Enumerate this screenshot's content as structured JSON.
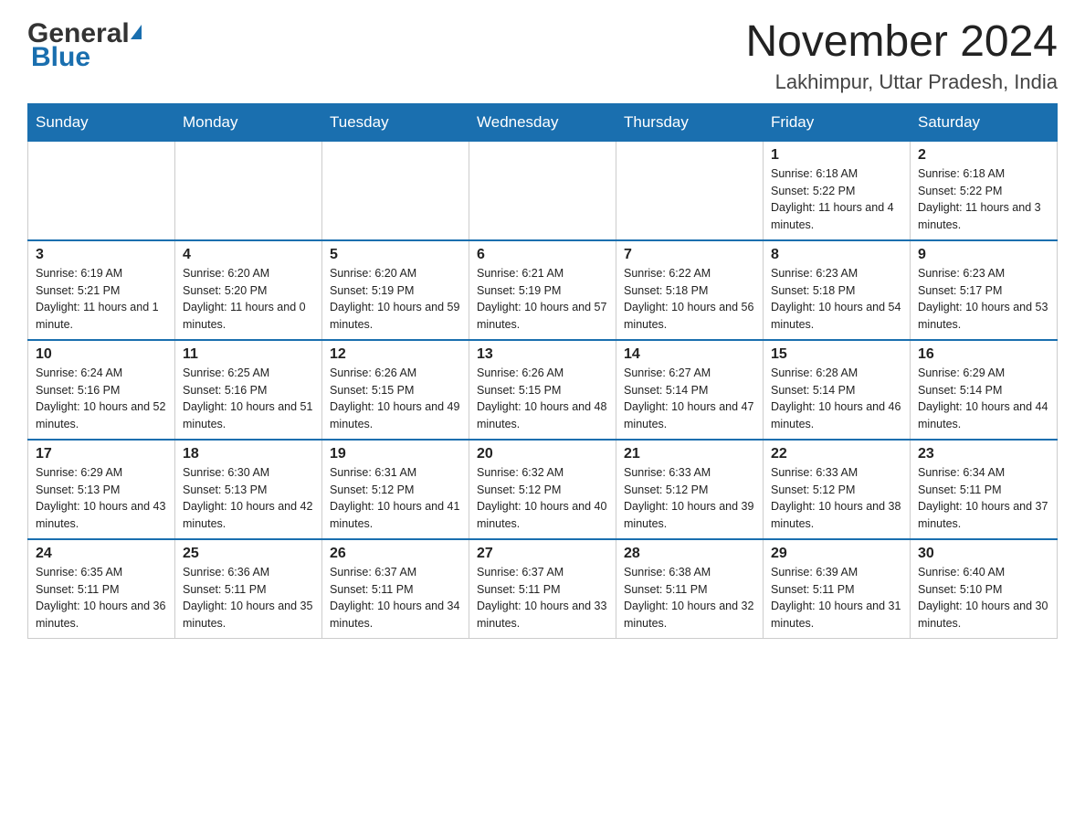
{
  "logo": {
    "general": "General",
    "blue": "Blue"
  },
  "header": {
    "month_year": "November 2024",
    "location": "Lakhimpur, Uttar Pradesh, India"
  },
  "weekdays": [
    "Sunday",
    "Monday",
    "Tuesday",
    "Wednesday",
    "Thursday",
    "Friday",
    "Saturday"
  ],
  "weeks": [
    [
      {
        "day": "",
        "info": ""
      },
      {
        "day": "",
        "info": ""
      },
      {
        "day": "",
        "info": ""
      },
      {
        "day": "",
        "info": ""
      },
      {
        "day": "",
        "info": ""
      },
      {
        "day": "1",
        "info": "Sunrise: 6:18 AM\nSunset: 5:22 PM\nDaylight: 11 hours and 4 minutes."
      },
      {
        "day": "2",
        "info": "Sunrise: 6:18 AM\nSunset: 5:22 PM\nDaylight: 11 hours and 3 minutes."
      }
    ],
    [
      {
        "day": "3",
        "info": "Sunrise: 6:19 AM\nSunset: 5:21 PM\nDaylight: 11 hours and 1 minute."
      },
      {
        "day": "4",
        "info": "Sunrise: 6:20 AM\nSunset: 5:20 PM\nDaylight: 11 hours and 0 minutes."
      },
      {
        "day": "5",
        "info": "Sunrise: 6:20 AM\nSunset: 5:19 PM\nDaylight: 10 hours and 59 minutes."
      },
      {
        "day": "6",
        "info": "Sunrise: 6:21 AM\nSunset: 5:19 PM\nDaylight: 10 hours and 57 minutes."
      },
      {
        "day": "7",
        "info": "Sunrise: 6:22 AM\nSunset: 5:18 PM\nDaylight: 10 hours and 56 minutes."
      },
      {
        "day": "8",
        "info": "Sunrise: 6:23 AM\nSunset: 5:18 PM\nDaylight: 10 hours and 54 minutes."
      },
      {
        "day": "9",
        "info": "Sunrise: 6:23 AM\nSunset: 5:17 PM\nDaylight: 10 hours and 53 minutes."
      }
    ],
    [
      {
        "day": "10",
        "info": "Sunrise: 6:24 AM\nSunset: 5:16 PM\nDaylight: 10 hours and 52 minutes."
      },
      {
        "day": "11",
        "info": "Sunrise: 6:25 AM\nSunset: 5:16 PM\nDaylight: 10 hours and 51 minutes."
      },
      {
        "day": "12",
        "info": "Sunrise: 6:26 AM\nSunset: 5:15 PM\nDaylight: 10 hours and 49 minutes."
      },
      {
        "day": "13",
        "info": "Sunrise: 6:26 AM\nSunset: 5:15 PM\nDaylight: 10 hours and 48 minutes."
      },
      {
        "day": "14",
        "info": "Sunrise: 6:27 AM\nSunset: 5:14 PM\nDaylight: 10 hours and 47 minutes."
      },
      {
        "day": "15",
        "info": "Sunrise: 6:28 AM\nSunset: 5:14 PM\nDaylight: 10 hours and 46 minutes."
      },
      {
        "day": "16",
        "info": "Sunrise: 6:29 AM\nSunset: 5:14 PM\nDaylight: 10 hours and 44 minutes."
      }
    ],
    [
      {
        "day": "17",
        "info": "Sunrise: 6:29 AM\nSunset: 5:13 PM\nDaylight: 10 hours and 43 minutes."
      },
      {
        "day": "18",
        "info": "Sunrise: 6:30 AM\nSunset: 5:13 PM\nDaylight: 10 hours and 42 minutes."
      },
      {
        "day": "19",
        "info": "Sunrise: 6:31 AM\nSunset: 5:12 PM\nDaylight: 10 hours and 41 minutes."
      },
      {
        "day": "20",
        "info": "Sunrise: 6:32 AM\nSunset: 5:12 PM\nDaylight: 10 hours and 40 minutes."
      },
      {
        "day": "21",
        "info": "Sunrise: 6:33 AM\nSunset: 5:12 PM\nDaylight: 10 hours and 39 minutes."
      },
      {
        "day": "22",
        "info": "Sunrise: 6:33 AM\nSunset: 5:12 PM\nDaylight: 10 hours and 38 minutes."
      },
      {
        "day": "23",
        "info": "Sunrise: 6:34 AM\nSunset: 5:11 PM\nDaylight: 10 hours and 37 minutes."
      }
    ],
    [
      {
        "day": "24",
        "info": "Sunrise: 6:35 AM\nSunset: 5:11 PM\nDaylight: 10 hours and 36 minutes."
      },
      {
        "day": "25",
        "info": "Sunrise: 6:36 AM\nSunset: 5:11 PM\nDaylight: 10 hours and 35 minutes."
      },
      {
        "day": "26",
        "info": "Sunrise: 6:37 AM\nSunset: 5:11 PM\nDaylight: 10 hours and 34 minutes."
      },
      {
        "day": "27",
        "info": "Sunrise: 6:37 AM\nSunset: 5:11 PM\nDaylight: 10 hours and 33 minutes."
      },
      {
        "day": "28",
        "info": "Sunrise: 6:38 AM\nSunset: 5:11 PM\nDaylight: 10 hours and 32 minutes."
      },
      {
        "day": "29",
        "info": "Sunrise: 6:39 AM\nSunset: 5:11 PM\nDaylight: 10 hours and 31 minutes."
      },
      {
        "day": "30",
        "info": "Sunrise: 6:40 AM\nSunset: 5:10 PM\nDaylight: 10 hours and 30 minutes."
      }
    ]
  ]
}
